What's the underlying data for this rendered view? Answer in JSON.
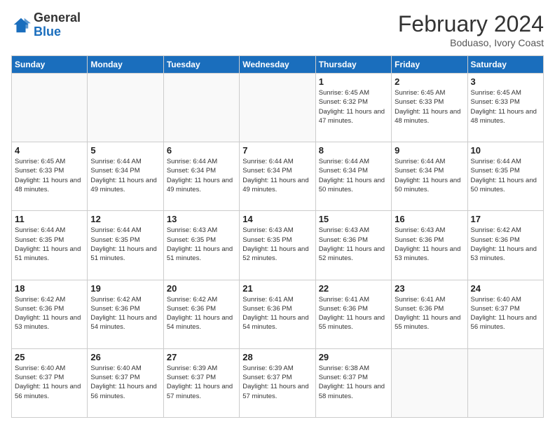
{
  "logo": {
    "general": "General",
    "blue": "Blue"
  },
  "header": {
    "month": "February 2024",
    "location": "Boduaso, Ivory Coast"
  },
  "weekdays": [
    "Sunday",
    "Monday",
    "Tuesday",
    "Wednesday",
    "Thursday",
    "Friday",
    "Saturday"
  ],
  "weeks": [
    [
      {
        "day": "",
        "info": ""
      },
      {
        "day": "",
        "info": ""
      },
      {
        "day": "",
        "info": ""
      },
      {
        "day": "",
        "info": ""
      },
      {
        "day": "1",
        "info": "Sunrise: 6:45 AM\nSunset: 6:32 PM\nDaylight: 11 hours and 47 minutes."
      },
      {
        "day": "2",
        "info": "Sunrise: 6:45 AM\nSunset: 6:33 PM\nDaylight: 11 hours and 48 minutes."
      },
      {
        "day": "3",
        "info": "Sunrise: 6:45 AM\nSunset: 6:33 PM\nDaylight: 11 hours and 48 minutes."
      }
    ],
    [
      {
        "day": "4",
        "info": "Sunrise: 6:45 AM\nSunset: 6:33 PM\nDaylight: 11 hours and 48 minutes."
      },
      {
        "day": "5",
        "info": "Sunrise: 6:44 AM\nSunset: 6:34 PM\nDaylight: 11 hours and 49 minutes."
      },
      {
        "day": "6",
        "info": "Sunrise: 6:44 AM\nSunset: 6:34 PM\nDaylight: 11 hours and 49 minutes."
      },
      {
        "day": "7",
        "info": "Sunrise: 6:44 AM\nSunset: 6:34 PM\nDaylight: 11 hours and 49 minutes."
      },
      {
        "day": "8",
        "info": "Sunrise: 6:44 AM\nSunset: 6:34 PM\nDaylight: 11 hours and 50 minutes."
      },
      {
        "day": "9",
        "info": "Sunrise: 6:44 AM\nSunset: 6:34 PM\nDaylight: 11 hours and 50 minutes."
      },
      {
        "day": "10",
        "info": "Sunrise: 6:44 AM\nSunset: 6:35 PM\nDaylight: 11 hours and 50 minutes."
      }
    ],
    [
      {
        "day": "11",
        "info": "Sunrise: 6:44 AM\nSunset: 6:35 PM\nDaylight: 11 hours and 51 minutes."
      },
      {
        "day": "12",
        "info": "Sunrise: 6:44 AM\nSunset: 6:35 PM\nDaylight: 11 hours and 51 minutes."
      },
      {
        "day": "13",
        "info": "Sunrise: 6:43 AM\nSunset: 6:35 PM\nDaylight: 11 hours and 51 minutes."
      },
      {
        "day": "14",
        "info": "Sunrise: 6:43 AM\nSunset: 6:35 PM\nDaylight: 11 hours and 52 minutes."
      },
      {
        "day": "15",
        "info": "Sunrise: 6:43 AM\nSunset: 6:36 PM\nDaylight: 11 hours and 52 minutes."
      },
      {
        "day": "16",
        "info": "Sunrise: 6:43 AM\nSunset: 6:36 PM\nDaylight: 11 hours and 53 minutes."
      },
      {
        "day": "17",
        "info": "Sunrise: 6:42 AM\nSunset: 6:36 PM\nDaylight: 11 hours and 53 minutes."
      }
    ],
    [
      {
        "day": "18",
        "info": "Sunrise: 6:42 AM\nSunset: 6:36 PM\nDaylight: 11 hours and 53 minutes."
      },
      {
        "day": "19",
        "info": "Sunrise: 6:42 AM\nSunset: 6:36 PM\nDaylight: 11 hours and 54 minutes."
      },
      {
        "day": "20",
        "info": "Sunrise: 6:42 AM\nSunset: 6:36 PM\nDaylight: 11 hours and 54 minutes."
      },
      {
        "day": "21",
        "info": "Sunrise: 6:41 AM\nSunset: 6:36 PM\nDaylight: 11 hours and 54 minutes."
      },
      {
        "day": "22",
        "info": "Sunrise: 6:41 AM\nSunset: 6:36 PM\nDaylight: 11 hours and 55 minutes."
      },
      {
        "day": "23",
        "info": "Sunrise: 6:41 AM\nSunset: 6:36 PM\nDaylight: 11 hours and 55 minutes."
      },
      {
        "day": "24",
        "info": "Sunrise: 6:40 AM\nSunset: 6:37 PM\nDaylight: 11 hours and 56 minutes."
      }
    ],
    [
      {
        "day": "25",
        "info": "Sunrise: 6:40 AM\nSunset: 6:37 PM\nDaylight: 11 hours and 56 minutes."
      },
      {
        "day": "26",
        "info": "Sunrise: 6:40 AM\nSunset: 6:37 PM\nDaylight: 11 hours and 56 minutes."
      },
      {
        "day": "27",
        "info": "Sunrise: 6:39 AM\nSunset: 6:37 PM\nDaylight: 11 hours and 57 minutes."
      },
      {
        "day": "28",
        "info": "Sunrise: 6:39 AM\nSunset: 6:37 PM\nDaylight: 11 hours and 57 minutes."
      },
      {
        "day": "29",
        "info": "Sunrise: 6:38 AM\nSunset: 6:37 PM\nDaylight: 11 hours and 58 minutes."
      },
      {
        "day": "",
        "info": ""
      },
      {
        "day": "",
        "info": ""
      }
    ]
  ]
}
